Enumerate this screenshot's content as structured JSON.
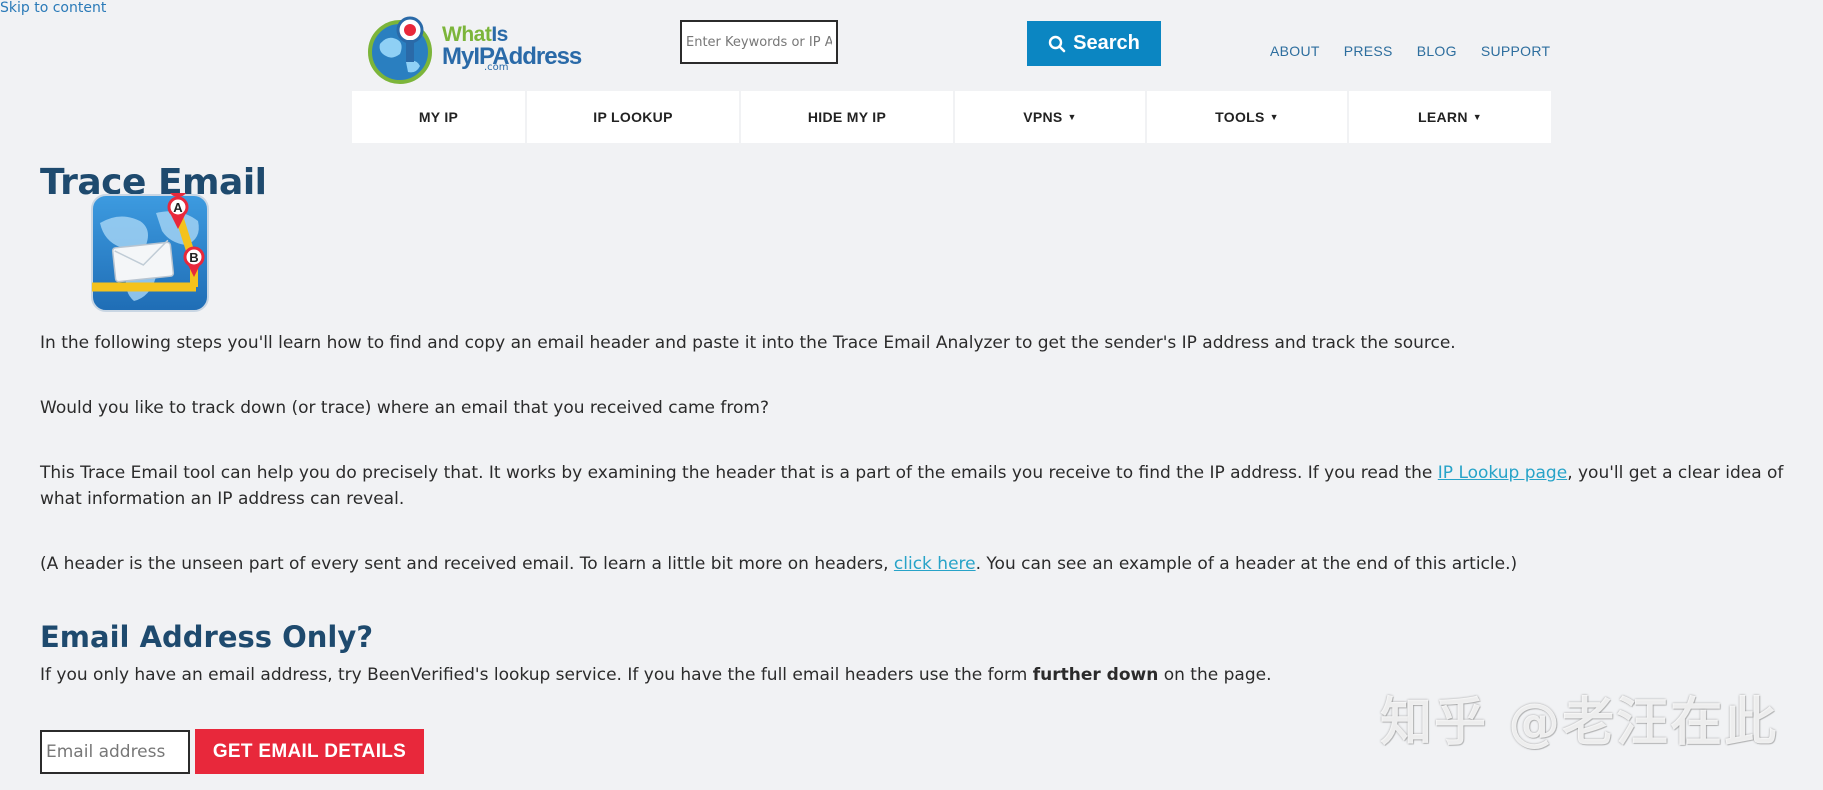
{
  "skip_link": "Skip to content",
  "logo": {
    "line1_a": "What",
    "line1_b": "Is",
    "line2": "MyIPAddress",
    "line3": ".com"
  },
  "header_search": {
    "placeholder": "Enter Keywords or IP Address",
    "button_label": "Search"
  },
  "top_links": [
    "ABOUT",
    "PRESS",
    "BLOG",
    "SUPPORT"
  ],
  "nav": [
    {
      "label": "MY IP",
      "dropdown": false
    },
    {
      "label": "IP LOOKUP",
      "dropdown": false
    },
    {
      "label": "HIDE MY IP",
      "dropdown": false
    },
    {
      "label": "VPNS",
      "dropdown": true
    },
    {
      "label": "TOOLS",
      "dropdown": true
    },
    {
      "label": "LEARN",
      "dropdown": true
    }
  ],
  "dropdown_caret": "▼",
  "page": {
    "title": "Trace Email",
    "icon_pins": {
      "a": "A",
      "b": "B"
    },
    "p1": "In the following steps you'll learn how to find and copy an email header and paste it into the Trace Email Analyzer to get the sender's IP address and track the source.",
    "p2": "Would you like to track down (or trace) where an email that you received came from?",
    "p3_before": "This Trace Email tool can help you do precisely that. It works by examining the header that is a part of the emails you receive to find the IP address. If you read the ",
    "p3_link": "IP Lookup page",
    "p3_after": ", you'll get a clear idea of what information an IP address can reveal.",
    "p4_before": "(A header is the unseen part of every sent and received email. To learn a little bit more on headers, ",
    "p4_link": "click here",
    "p4_after": ". You can see an example of a header at the end of this article.)",
    "h2": "Email Address Only?",
    "p5_before": "If you only have an email address, try BeenVerified's lookup service. If you have the full email headers use the form ",
    "p5_bold": "further down",
    "p5_after": " on the page.",
    "email_placeholder": "Email address",
    "email_button": "GET EMAIL DETAILS"
  },
  "watermark": "知乎 @老汪在此",
  "colors": {
    "background": "#f1f2f4",
    "heading": "#1e4a6e",
    "search_button": "#0b86c2",
    "cta_button": "#e8283b",
    "link": "#27a3c8",
    "top_link": "#2d6e9e"
  }
}
